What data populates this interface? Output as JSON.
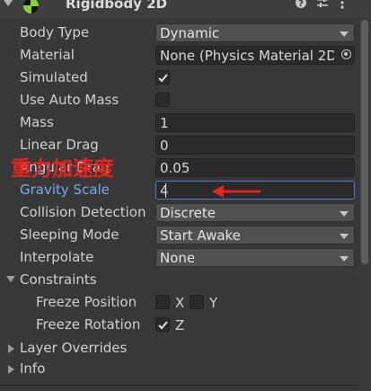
{
  "component": {
    "title": "Rigidbody 2D",
    "icon": "rigidbody2d-icon",
    "header_icons": [
      "help-icon",
      "preset-icon",
      "more-icon"
    ]
  },
  "fields": {
    "body_type": {
      "label": "Body Type",
      "value": "Dynamic"
    },
    "material": {
      "label": "Material",
      "value": "None (Physics Material 2D)"
    },
    "simulated": {
      "label": "Simulated",
      "checked": true
    },
    "use_auto_mass": {
      "label": "Use Auto Mass",
      "checked": false
    },
    "mass": {
      "label": "Mass",
      "value": "1"
    },
    "linear_drag": {
      "label": "Linear Drag",
      "value": "0"
    },
    "angular_drag": {
      "label": "Angular Drag",
      "value": "0.05"
    },
    "gravity_scale": {
      "label": "Gravity Scale",
      "value": "4"
    },
    "collision_detection": {
      "label": "Collision Detection",
      "value": "Discrete"
    },
    "sleeping_mode": {
      "label": "Sleeping Mode",
      "value": "Start Awake"
    },
    "interpolate": {
      "label": "Interpolate",
      "value": "None"
    }
  },
  "constraints": {
    "label": "Constraints",
    "freeze_position": {
      "label": "Freeze Position",
      "x_label": "X",
      "y_label": "Y",
      "x": false,
      "y": false
    },
    "freeze_rotation": {
      "label": "Freeze Rotation",
      "z_label": "Z",
      "z": true
    }
  },
  "sections": {
    "layer_overrides": "Layer Overrides",
    "info": "Info"
  },
  "annotation": {
    "text": "重力加速度",
    "color": "#e8231f"
  }
}
